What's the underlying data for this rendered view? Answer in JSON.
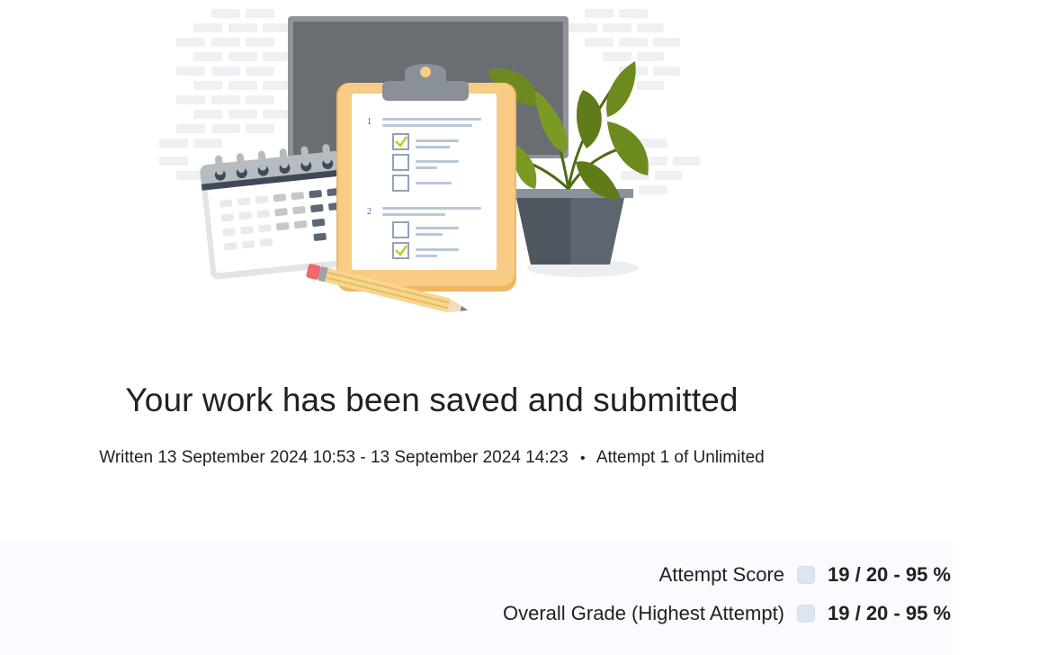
{
  "heading": "Your work has been saved and submitted",
  "meta": {
    "written": "Written 13 September 2024 10:53 - 13 September 2024 14:23",
    "separator": "•",
    "attempt": "Attempt 1 of Unlimited"
  },
  "scores": [
    {
      "label": "Attempt Score",
      "value": "19 / 20 - 95 %"
    },
    {
      "label": "Overall Grade (Highest Attempt)",
      "value": "19 / 20 - 95 %"
    }
  ],
  "illustration": {
    "clipboard_numbers": [
      "1",
      "2"
    ],
    "icons": [
      "brick-wall",
      "monitor",
      "calendar-icon",
      "clipboard-icon",
      "plant-icon",
      "pencil-icon"
    ]
  },
  "colors": {
    "clipboard": "#f7c97c",
    "plant_leaf": "#6d8a1f",
    "pot": "#5d6670",
    "checkmark": "#c5c92a",
    "score_bg": "#f9fbff"
  }
}
